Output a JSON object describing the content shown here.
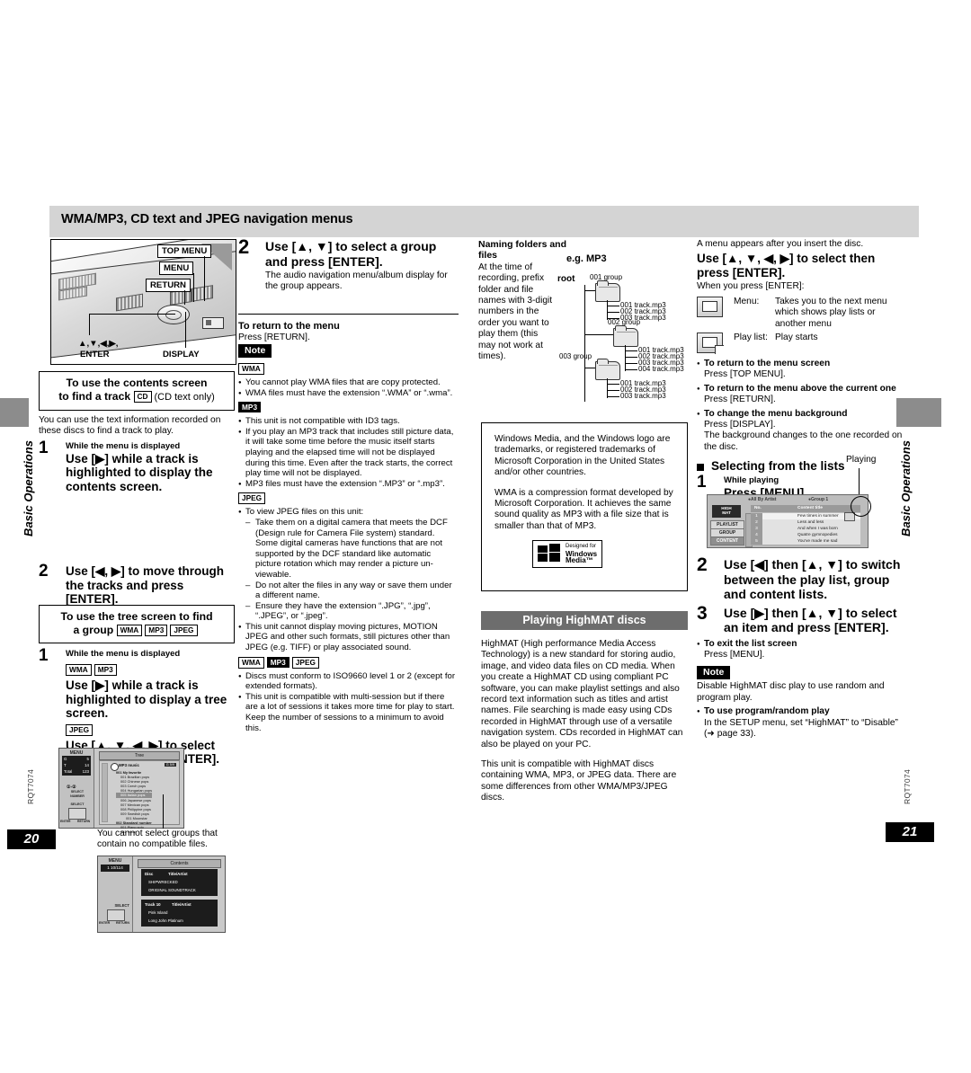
{
  "document": {
    "header_title": "WMA/MP3, CD text and JPEG navigation menus",
    "side_label_left": "Basic Operations",
    "side_label_right": "Basic Operations",
    "doc_code_left": "RQT7074",
    "doc_code_right": "RQT7074",
    "page_left": "20",
    "page_right": "21"
  },
  "player_illustration": {
    "callouts": [
      "TOP MENU",
      "MENU",
      "RETURN",
      "DISPLAY"
    ],
    "dpad_label_line1": "▲,▼,◀,▶,",
    "dpad_label_line2": "ENTER"
  },
  "contents_box": {
    "line1": "To use the contents screen",
    "line2_pre": "to find a track",
    "tag": "CD",
    "line2_post": "(CD text only)",
    "intro": "You can use the text information recorded on these discs to find a track to play.",
    "step1": {
      "num": "1",
      "pre": "While the menu is displayed",
      "text": "Use [▶] while a track is highlighted to display the contents screen."
    },
    "step2": {
      "num": "2",
      "text": "Use [◀, ▶] to move through the tracks and press [ENTER]."
    },
    "screen": {
      "menu_label": "MENU",
      "counter": "1   10/114",
      "title": "Contents",
      "disc_hdr_left": "Disc",
      "disc_hdr_right": "Title/Artist",
      "disc_rows": [
        "SHIPWRECKED",
        "ORIGINAL SOUNDTRACK"
      ],
      "track_hdr_left": "Track 10",
      "track_hdr_right": "Title/Artist",
      "track_rows": [
        "Pink Island",
        "Long John Platinum"
      ],
      "pad_select": "SELECT",
      "pad_enter": "ENTER",
      "pad_return": "RETURN"
    }
  },
  "tree_box": {
    "line1": "To use the tree screen to find",
    "line2": "a group",
    "tags": [
      "WMA",
      "MP3",
      "JPEG"
    ],
    "step1": {
      "num": "1",
      "pre": "While the menu is displayed",
      "tags_a": [
        "WMA",
        "MP3"
      ],
      "text_a": "Use [▶] while a track is highlighted to display a tree screen.",
      "tag_b": "JPEG",
      "text_b": "Use [▲, ▼, ◀, ▶] to select “Tree” and press [ENTER]."
    },
    "caption": "You cannot select groups that contain no compatible files.",
    "screen": {
      "menu_label": "MENU",
      "stat_g_label": "G",
      "stat_g_val": "5",
      "stat_t_label": "T",
      "stat_t_val": "14",
      "stat_total_label": "Total",
      "stat_total_val": "123",
      "title": "Tree",
      "badge": "G  5/9",
      "root": "MP3 music",
      "items": [
        "001 My favorite",
        "001 Brazilian pops",
        "002 Chinese pops",
        "003 Czech pops",
        "004 Hungarian pops",
        "005 Italian pops",
        "006 Japanese pops",
        "007 Mexican pops",
        "008 Philippine pops",
        "009 Swedish pops",
        "001 Moonstar",
        "002 Standard number",
        "001 Piano solo",
        "002 Vocal"
      ],
      "pad_select_number": "SELECT NUMBER",
      "pad_select": "SELECT",
      "pad_enter": "ENTER",
      "pad_return": "RETURN"
    }
  },
  "step2_group": {
    "num": "2",
    "title": "Use [▲, ▼] to select a group and press [ENTER].",
    "body": "The audio navigation menu/album display for the group appears.",
    "return_head": "To return to the menu",
    "return_body": "Press [RETURN]."
  },
  "notes_left": {
    "badge": "Note",
    "groups": [
      {
        "tag": "WMA",
        "items": [
          "You cannot play WMA files that are copy protected.",
          "WMA files must have the extension “.WMA” or “.wma”."
        ]
      },
      {
        "tag": "MP3",
        "items": [
          "This unit is not compatible with ID3 tags.",
          "If you play an MP3 track that includes still picture data, it will take some time before the music itself starts playing and the elapsed time will not be displayed during this time. Even after the track starts, the correct play time will not be displayed.",
          "MP3 files must have the extension “.MP3” or “.mp3”."
        ]
      },
      {
        "tag": "JPEG",
        "items": [
          "To view JPEG files on this unit:"
        ],
        "dashes": [
          "Take them on a digital camera that meets the DCF (Design rule for Camera File system) standard. Some digital cameras have functions that are not supported by the DCF standard like automatic picture rotation which may render a picture un-viewable.",
          "Do not alter the files in any way or save them under a different name.",
          "Ensure they have the extension “.JPG”, “.jpg”, “.JPEG”, or “.jpeg”."
        ],
        "items_after": [
          "This unit cannot display moving pictures, MOTION JPEG and other such formats, still pictures other than JPEG (e.g. TIFF) or play associated sound."
        ]
      },
      {
        "tags": [
          "WMA",
          "MP3",
          "JPEG"
        ],
        "items": [
          "Discs must conform to ISO9660 level 1 or 2 (except for extended formats).",
          "This unit is compatible with multi-session but if there are a lot of sessions it takes more time for play to start. Keep the number of sessions to a minimum to avoid this."
        ]
      }
    ]
  },
  "naming": {
    "heading": "Naming folders and files",
    "body": "At the time of recording, prefix folder and file names with 3-digit numbers in the order you want to play them (this may not work at times).",
    "example_label": "e.g. MP3",
    "root_label": "root",
    "groups": [
      {
        "name": "001 group",
        "files": [
          "001 track.mp3",
          "002 track.mp3",
          "003 track.mp3"
        ]
      },
      {
        "name": "002 group",
        "files": [
          "001 track.mp3",
          "002 track.mp3",
          "003 track.mp3",
          "004 track.mp3"
        ]
      },
      {
        "name": "003 group",
        "files": [
          "001 track.mp3",
          "002 track.mp3",
          "003 track.mp3"
        ]
      }
    ]
  },
  "trademark_box": {
    "p1": "Windows Media, and the Windows logo are trademarks, or registered trademarks of Microsoft Corporation in the United States and/or other countries.",
    "p2": "WMA is a compression format developed by Microsoft Corporation. It achieves the same sound quality as MP3 with a file size that is smaller than that of MP3.",
    "logo_line1": "Designed for",
    "logo_line2": "Windows",
    "logo_line3": "Media™"
  },
  "highmat": {
    "bar_title": "Playing HighMAT discs",
    "p1": "HighMAT (High performance Media Access Technology) is a new standard for storing audio, image, and video data files on CD media. When you create a HighMAT CD using compliant PC software, you can make playlist settings and also record text information such as titles and artist names. File searching is made easy using CDs recorded in HighMAT through use of a versatile navigation system. CDs recorded in HighMAT can also be played on your PC.",
    "p2": "This unit is compatible with HighMAT discs containing WMA, MP3, or JPEG data. There are some differences from other WMA/MP3/JPEG discs."
  },
  "right_col": {
    "intro": "A menu appears after you insert the disc.",
    "heading": "Use [▲, ▼, ◀, ▶] to select then press [ENTER].",
    "sub": "When you press [ENTER]:",
    "icon_rows": [
      {
        "label": "Menu:",
        "desc": "Takes you to the next menu which shows play lists or another menu"
      },
      {
        "label": "Play list:",
        "desc": "Play starts"
      }
    ],
    "bullets": [
      {
        "head": "To return to the menu screen",
        "body": "Press [TOP MENU]."
      },
      {
        "head": "To return to the menu above the current one",
        "body": "Press [RETURN]."
      },
      {
        "head": "To change the menu background",
        "body": "Press [DISPLAY].",
        "extra": "The background changes to the one recorded on the disc."
      }
    ],
    "lists_heading": "Selecting from the lists",
    "step1": {
      "num": "1",
      "pre": "While playing",
      "text": "Press [MENU]."
    },
    "playing_label": "Playing",
    "step2": {
      "num": "2",
      "text": "Use [◀] then [▲, ▼] to switch between the play list, group and content lists."
    },
    "step3": {
      "num": "3",
      "text": "Use [▶] then [▲, ▼] to select an item and press [ENTER]."
    },
    "exit_head": "To exit the list screen",
    "exit_body": "Press [MENU].",
    "note_badge": "Note",
    "note_body": "Disable HighMAT disc play to use random and program play.",
    "note_bullet_head": "To use program/random play",
    "note_bullet_body": "In the SETUP menu, set “HighMAT” to “Disable” (➜ page 33).",
    "screen": {
      "logo_l1": "HIGH",
      "logo_l2": "MAT",
      "btn_playlist": "PLAYLIST",
      "btn_group": "GROUP",
      "btn_content": "CONTENT",
      "tab_all": "All By Artist",
      "tab_group": "Group 1",
      "col_no": "No.",
      "col_title": "Content title",
      "rows": [
        {
          "no": "1",
          "title": "Few times in summer"
        },
        {
          "no": "2",
          "title": "Less and less"
        },
        {
          "no": "3",
          "title": "And when I was born"
        },
        {
          "no": "4",
          "title": "Quatre gymnopedies"
        },
        {
          "no": "5",
          "title": "You've made me sad"
        }
      ]
    }
  }
}
